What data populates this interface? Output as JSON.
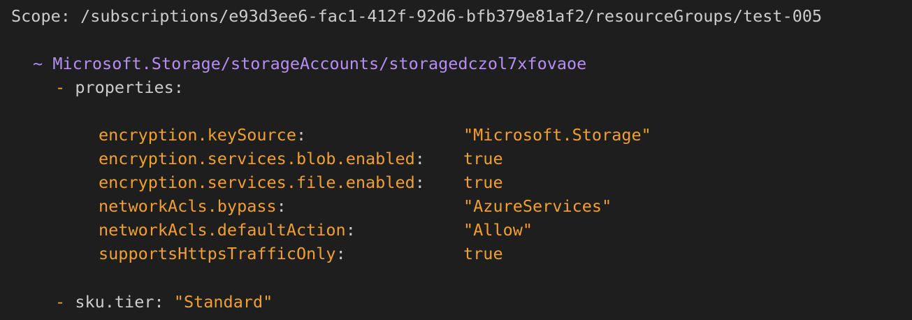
{
  "scope": {
    "label": "Scope:",
    "path": "/subscriptions/e93d3ee6-fac1-412f-92d6-bfb379e81af2/resourceGroups/test-005"
  },
  "resource": {
    "symbol": "~",
    "name": "Microsoft.Storage/storageAccounts/storagedczol7xfovaoe"
  },
  "properties_header": {
    "symbol": "-",
    "label": "properties:"
  },
  "properties": [
    {
      "key": "encryption.keySource",
      "value": "\"Microsoft.Storage\""
    },
    {
      "key": "encryption.services.blob.enabled",
      "value": "true"
    },
    {
      "key": "encryption.services.file.enabled",
      "value": "true"
    },
    {
      "key": "networkAcls.bypass",
      "value": "\"AzureServices\""
    },
    {
      "key": "networkAcls.defaultAction",
      "value": "\"Allow\""
    },
    {
      "key": "supportsHttpsTrafficOnly",
      "value": "true"
    }
  ],
  "sku": {
    "symbol": "-",
    "key": "sku.tier:",
    "value": "\"Standard\""
  },
  "colors": {
    "background": "#1e1e1e",
    "text": "#cccccc",
    "orange": "#f0a030",
    "purple": "#b48ef5"
  }
}
